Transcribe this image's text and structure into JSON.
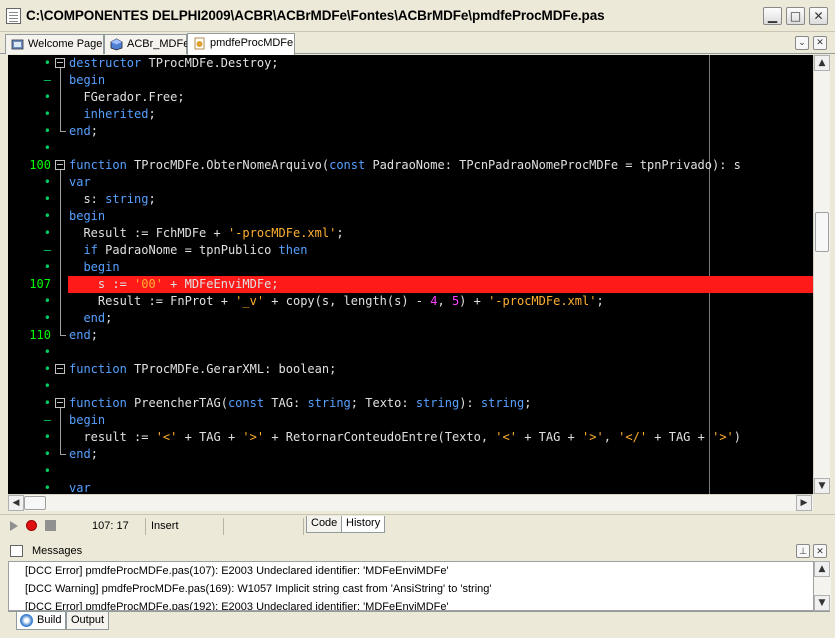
{
  "window": {
    "title": "C:\\COMPONENTES DELPHI2009\\ACBR\\ACBrMDFe\\Fontes\\ACBrMDFe\\pmdfeProcMDFe.pas",
    "icon": "document-icon",
    "minimize": "minimize-icon",
    "maximize": "maximize-icon",
    "close": "close-icon"
  },
  "tabs": [
    {
      "label": "Welcome Page",
      "icon": "home-page-icon",
      "active": false
    },
    {
      "label": "ACBr_MDFe",
      "icon": "project-icon",
      "active": false
    },
    {
      "label": "pmdfeProcMDFe",
      "icon": "unit-icon",
      "active": true
    }
  ],
  "editor": {
    "lines": [
      {
        "num": "•",
        "fold": "open",
        "text": [
          [
            "kw",
            "destructor"
          ],
          [
            "t",
            " TProcMDFe.Destroy;"
          ]
        ]
      },
      {
        "num": "–",
        "text": [
          [
            "kw",
            "begin"
          ]
        ]
      },
      {
        "num": "•",
        "text": [
          [
            "t",
            "  FGerador.Free;"
          ]
        ]
      },
      {
        "num": "•",
        "text": [
          [
            "t",
            "  "
          ],
          [
            "kw",
            "inherited"
          ],
          [
            "t",
            ";"
          ]
        ]
      },
      {
        "num": "•",
        "foldend": true,
        "text": [
          [
            "kw",
            "end"
          ],
          [
            "t",
            ";"
          ]
        ]
      },
      {
        "num": "•",
        "text": []
      },
      {
        "num": "100",
        "fold": "open",
        "text": [
          [
            "kw",
            "function"
          ],
          [
            "t",
            " TProcMDFe.ObterNomeArquivo("
          ],
          [
            "kw",
            "const"
          ],
          [
            "t",
            " PadraoNome: TPcnPadraoNomeProcMDFe = tpnPrivado): s"
          ]
        ]
      },
      {
        "num": "•",
        "text": [
          [
            "kw",
            "var"
          ]
        ]
      },
      {
        "num": "•",
        "text": [
          [
            "t",
            "  s: "
          ],
          [
            "kw",
            "string"
          ],
          [
            "t",
            ";"
          ]
        ]
      },
      {
        "num": "•",
        "text": [
          [
            "kw",
            "begin"
          ]
        ]
      },
      {
        "num": "•",
        "text": [
          [
            "t",
            "  Result := FchMDFe + "
          ],
          [
            "str",
            "'-procMDFe.xml'"
          ],
          [
            "t",
            ";"
          ]
        ]
      },
      {
        "num": "–",
        "text": [
          [
            "t",
            "  "
          ],
          [
            "kw",
            "if"
          ],
          [
            "t",
            " PadraoNome = tpnPublico "
          ],
          [
            "kw",
            "then"
          ]
        ]
      },
      {
        "num": "•",
        "text": [
          [
            "t",
            "  "
          ],
          [
            "kw",
            "begin"
          ]
        ]
      },
      {
        "num": "107",
        "error": true,
        "text": [
          [
            "t",
            "    s := "
          ],
          [
            "str",
            "'00'"
          ],
          [
            "t",
            " + MDFeEnviMDFe;"
          ]
        ]
      },
      {
        "num": "•",
        "text": [
          [
            "t",
            "    Result := FnProt + "
          ],
          [
            "str",
            "'_v'"
          ],
          [
            "t",
            " + copy(s, length(s) - "
          ],
          [
            "num",
            "4"
          ],
          [
            "t",
            ", "
          ],
          [
            "num",
            "5"
          ],
          [
            "t",
            ") + "
          ],
          [
            "str",
            "'-procMDFe.xml'"
          ],
          [
            "t",
            ";"
          ]
        ]
      },
      {
        "num": "•",
        "text": [
          [
            "t",
            "  "
          ],
          [
            "kw",
            "end"
          ],
          [
            "t",
            ";"
          ]
        ]
      },
      {
        "num": "110",
        "foldend": true,
        "text": [
          [
            "kw",
            "end"
          ],
          [
            "t",
            ";"
          ]
        ]
      },
      {
        "num": "•",
        "text": []
      },
      {
        "num": "•",
        "fold": "open",
        "text": [
          [
            "kw",
            "function"
          ],
          [
            "t",
            " TProcMDFe.GerarXML: boolean;"
          ]
        ]
      },
      {
        "num": "•",
        "text": []
      },
      {
        "num": "•",
        "fold": "open",
        "text": [
          [
            "kw",
            "function"
          ],
          [
            "t",
            " PreencherTAG("
          ],
          [
            "kw",
            "const"
          ],
          [
            "t",
            " TAG: "
          ],
          [
            "kw",
            "string"
          ],
          [
            "t",
            "; Texto: "
          ],
          [
            "kw",
            "string"
          ],
          [
            "t",
            "): "
          ],
          [
            "kw",
            "string"
          ],
          [
            "t",
            ";"
          ]
        ]
      },
      {
        "num": "–",
        "text": [
          [
            "kw",
            "begin"
          ]
        ]
      },
      {
        "num": "•",
        "text": [
          [
            "t",
            "  result := "
          ],
          [
            "str",
            "'<'"
          ],
          [
            "t",
            " + TAG + "
          ],
          [
            "str",
            "'>'"
          ],
          [
            "t",
            " + RetornarConteudoEntre(Texto, "
          ],
          [
            "str",
            "'<'"
          ],
          [
            "t",
            " + TAG + "
          ],
          [
            "str",
            "'>'"
          ],
          [
            "t",
            ", "
          ],
          [
            "str",
            "'</'"
          ],
          [
            "t",
            " + TAG + "
          ],
          [
            "str",
            "'>'"
          ],
          [
            "t",
            ")"
          ]
        ]
      },
      {
        "num": "•",
        "foldend": true,
        "text": [
          [
            "kw",
            "end"
          ],
          [
            "t",
            ";"
          ]
        ]
      },
      {
        "num": "•",
        "text": []
      },
      {
        "num": "•",
        "text": [
          [
            "kw",
            "var"
          ]
        ]
      }
    ]
  },
  "status": {
    "position": "107: 17",
    "mode": "Insert",
    "view_tabs": [
      "Code",
      "History"
    ],
    "active_view": "History"
  },
  "messages": {
    "title": "Messages",
    "items": [
      "[DCC Error] pmdfeProcMDFe.pas(107): E2003 Undeclared identifier: 'MDFeEnviMDFe'",
      "[DCC Warning] pmdfeProcMDFe.pas(169): W1057 Implicit string cast from 'AnsiString' to 'string'",
      "[DCC Error] pmdfeProcMDFe.pas(192): E2003 Undeclared identifier: 'MDFeEnviMDFe'"
    ],
    "tabs": [
      {
        "label": "Build",
        "active": true
      },
      {
        "label": "Output",
        "active": false
      }
    ]
  },
  "colors": {
    "editor_bg": "#000000",
    "keyword": "#56a0ff",
    "string": "#ffb030",
    "number": "#ff40ff",
    "error_line": "#ff1a1a",
    "line_number": "#00ff00"
  }
}
